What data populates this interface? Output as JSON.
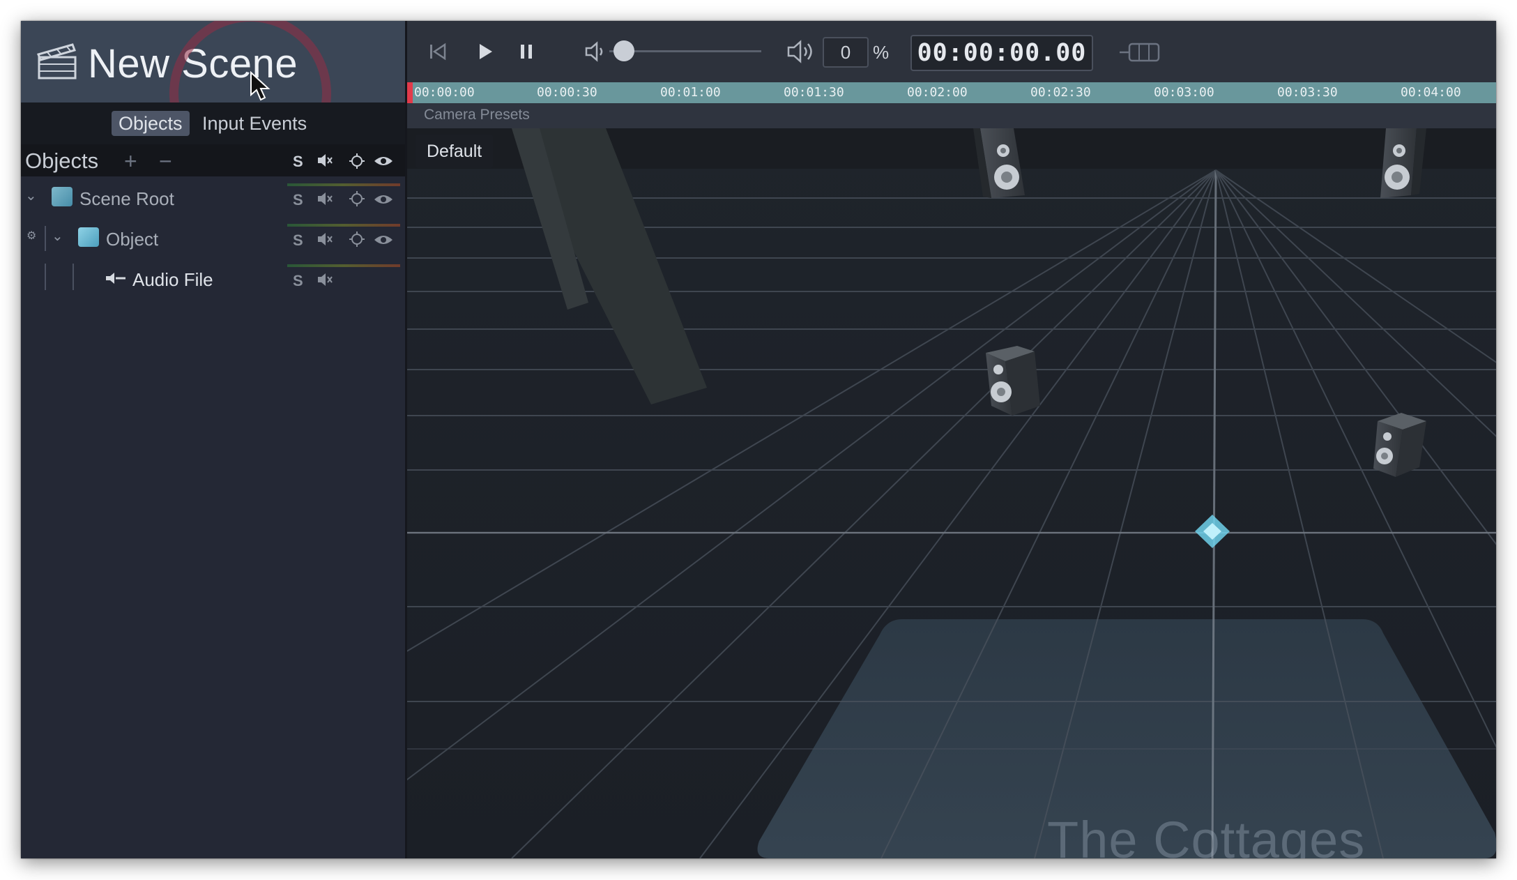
{
  "scene": {
    "title": "New Scene",
    "tabs": [
      {
        "label": "Objects",
        "active": true
      },
      {
        "label": "Input Events",
        "active": false
      }
    ]
  },
  "objects_panel": {
    "title": "Objects",
    "add_glyph": "+",
    "remove_glyph": "−",
    "column_icons": [
      "S",
      "mute-icon",
      "target-icon",
      "eye-icon"
    ],
    "tree": [
      {
        "label": "Scene Root",
        "icon": "scene-root-icon",
        "expanded": true
      },
      {
        "label": "Object",
        "icon": "object-icon",
        "expanded": true
      },
      {
        "label": "Audio File",
        "icon": "audio-file-icon"
      }
    ]
  },
  "transport": {
    "volume_value": "0",
    "volume_unit": "%",
    "volume_level": 0,
    "timecode": "00:00:00.00"
  },
  "timeline": {
    "ticks": [
      "00:00:00",
      "00:00:30",
      "00:01:00",
      "00:01:30",
      "00:02:00",
      "00:02:30",
      "00:03:00",
      "00:03:30",
      "00:04:00"
    ]
  },
  "camera": {
    "presets_label": "Camera Presets",
    "preset_button": "Default"
  },
  "viewport": {
    "venue_label": "The Cottages"
  },
  "colors": {
    "header_bg": "#3b4656",
    "ruler": "#69979c",
    "playhead": "#e23a4a",
    "listener_marker": "#6fd0ea"
  }
}
